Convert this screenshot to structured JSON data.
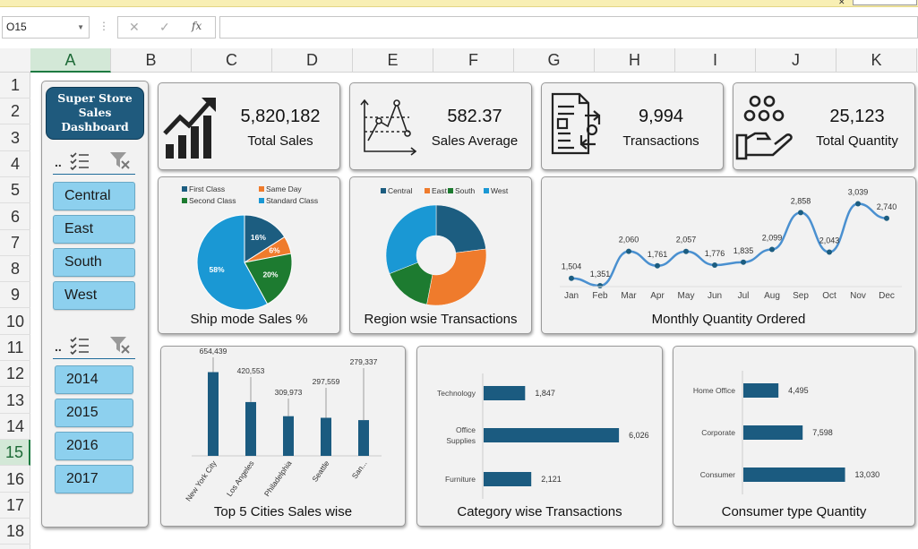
{
  "excel": {
    "name_box": "O15",
    "formula_icons": [
      "cancel-icon",
      "enter-icon",
      "function-icon"
    ],
    "formula_glyphs": {
      "cancel": "✕",
      "enter": "✓",
      "fx": "fx"
    },
    "columns": [
      "A",
      "B",
      "C",
      "D",
      "E",
      "F",
      "G",
      "H",
      "I",
      "J",
      "K"
    ],
    "rows": [
      "1",
      "2",
      "3",
      "4",
      "5",
      "6",
      "7",
      "8",
      "9",
      "10",
      "11",
      "12",
      "13",
      "14",
      "15",
      "16",
      "17",
      "18"
    ],
    "selected_column": "A",
    "selected_row": "15"
  },
  "sidebar": {
    "title_lines": [
      "Super Store",
      "Sales",
      "Dashboard"
    ],
    "slicer_dots": "..",
    "regions": [
      "Central",
      "East",
      "South",
      "West"
    ],
    "years": [
      "2014",
      "2015",
      "2016",
      "2017"
    ]
  },
  "kpis": [
    {
      "icon": "growth-chart-icon",
      "value": "5,820,182",
      "label": "Total Sales"
    },
    {
      "icon": "line-graph-icon",
      "value": "582.37",
      "label": "Sales Average"
    },
    {
      "icon": "transaction-document-icon",
      "value": "9,994",
      "label": "Transactions"
    },
    {
      "icon": "hand-coins-icon",
      "value": "25,123",
      "label": "Total Quantity"
    }
  ],
  "colors": {
    "dark_blue": "#1c5d80",
    "orange": "#ef7b2c",
    "green": "#1d7b30",
    "light_blue": "#1a98d4",
    "line_blue": "#4a90d0",
    "bar_blue": "#1b5b80"
  },
  "charts": {
    "ship_mode": {
      "title": "Ship mode Sales %",
      "chart_data": {
        "type": "pie",
        "categories": [
          "First Class",
          "Same Day",
          "Second Class",
          "Standard Class"
        ],
        "values": [
          16,
          6,
          20,
          58
        ],
        "labels": [
          "16%",
          "6%",
          "20%",
          "58%"
        ],
        "legend_position": "top"
      }
    },
    "region": {
      "title": "Region wsie Transactions",
      "chart_data": {
        "type": "pie",
        "donut": true,
        "categories": [
          "Central",
          "East",
          "South",
          "West"
        ],
        "values": [
          23,
          30,
          16,
          31
        ],
        "legend_position": "top"
      }
    },
    "monthly": {
      "title": "Monthly Quantity Ordered",
      "chart_data": {
        "type": "line",
        "categories": [
          "Jan",
          "Feb",
          "Mar",
          "Apr",
          "May",
          "Jun",
          "Jul",
          "Aug",
          "Sep",
          "Oct",
          "Nov",
          "Dec"
        ],
        "values": [
          1504,
          1351,
          2060,
          1761,
          2057,
          1776,
          1835,
          2099,
          2858,
          2043,
          3039,
          2740
        ],
        "labels": [
          "1,504",
          "1,351",
          "2,060",
          "1,761",
          "2,057",
          "1,776",
          "1,835",
          "2,099",
          "2,858",
          "2,043",
          "3,039",
          "2,740"
        ],
        "ylim": [
          1000,
          3400
        ],
        "grid": false
      }
    },
    "cities": {
      "title": "Top 5 Cities Sales wise",
      "chart_data": {
        "type": "bar",
        "categories": [
          "New York City",
          "Los Angeles",
          "Philadelphia",
          "Seattle",
          "San..."
        ],
        "values": [
          654439,
          420553,
          309973,
          297559,
          279337
        ],
        "labels": [
          "654,439",
          "420,553",
          "309,973",
          "297,559",
          "279,337"
        ],
        "ylim": [
          0,
          700000
        ]
      }
    },
    "category": {
      "title": "Category wise Transactions",
      "chart_data": {
        "type": "bar",
        "orientation": "horizontal",
        "categories": [
          "Technology",
          "Office Supplies",
          "Furniture"
        ],
        "category_lines": [
          [
            "Technology"
          ],
          [
            "Office",
            "Supplies"
          ],
          [
            "Furniture"
          ]
        ],
        "values": [
          1847,
          6026,
          2121
        ],
        "labels": [
          "1,847",
          "6,026",
          "2,121"
        ],
        "xlim": [
          0,
          6500
        ]
      }
    },
    "consumer": {
      "title": "Consumer type Quantity",
      "chart_data": {
        "type": "bar",
        "orientation": "horizontal",
        "categories": [
          "Home Office",
          "Corporate",
          "Consumer"
        ],
        "category_lines": [
          [
            "Home Office"
          ],
          [
            "Corporate"
          ],
          [
            "Consumer"
          ]
        ],
        "values": [
          4495,
          7598,
          13030
        ],
        "labels": [
          "4,495",
          "7,598",
          "13,030"
        ],
        "xlim": [
          0,
          14000
        ]
      }
    }
  }
}
